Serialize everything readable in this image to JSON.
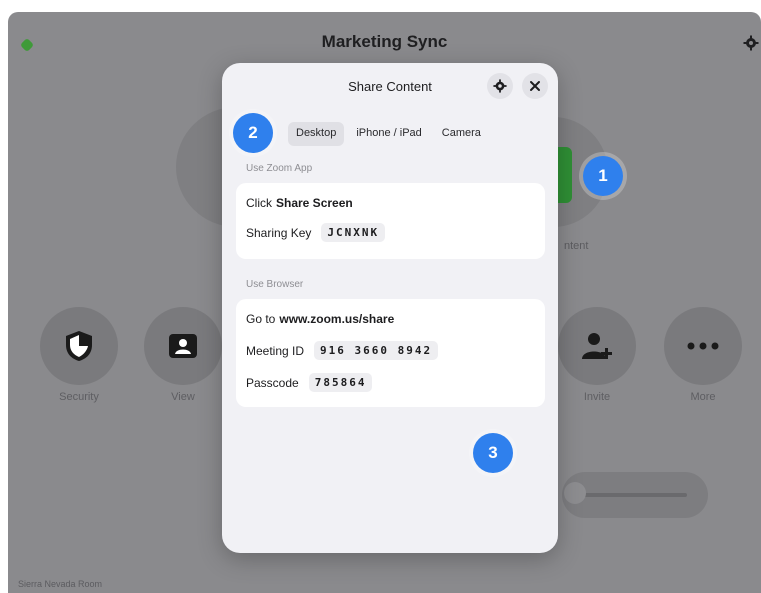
{
  "app": {
    "title": "Marketing Sync",
    "share_button_label": "ntent",
    "room_name": "Sierra Nevada Room",
    "controls": [
      {
        "label": "Security",
        "icon": "shield-icon"
      },
      {
        "label": "View",
        "icon": "person-card-icon"
      },
      {
        "label": "Invite",
        "icon": "add-person-icon"
      },
      {
        "label": "More",
        "icon": "more-icon"
      }
    ]
  },
  "modal": {
    "title": "Share Content",
    "tabs": [
      "Desktop",
      "iPhone / iPad",
      "Camera"
    ],
    "active_tab": "Desktop",
    "zoom_app": {
      "section_label": "Use Zoom App",
      "click_prefix": "Click ",
      "click_action": "Share Screen",
      "sharing_key_label": "Sharing Key",
      "sharing_key": "JCNXNK"
    },
    "browser": {
      "section_label": "Use Browser",
      "go_to_prefix": "Go to ",
      "url": "www.zoom.us/share",
      "meeting_id_label": "Meeting ID",
      "meeting_id": "916 3660 8942",
      "passcode_label": "Passcode",
      "passcode": "785864"
    }
  },
  "markers": [
    "1",
    "2",
    "3"
  ]
}
